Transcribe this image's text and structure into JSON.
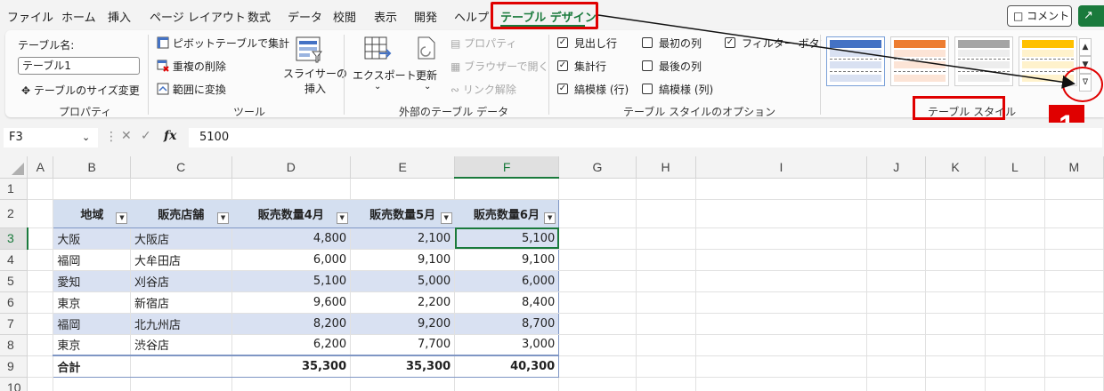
{
  "menu": {
    "items": [
      "ファイル",
      "ホーム",
      "挿入",
      "ページ レイアウト",
      "数式",
      "データ",
      "校閲",
      "表示",
      "開発",
      "ヘルプ",
      "テーブル デザイン"
    ],
    "comment_label": "コメント",
    "share_label": "共有"
  },
  "ribbon": {
    "properties": {
      "table_name_label": "テーブル名:",
      "table_name_value": "テーブル1",
      "resize_label": "テーブルのサイズ変更",
      "group_label": "プロパティ"
    },
    "tools": {
      "pivot_label": "ピボットテーブルで集計",
      "remove_dup_label": "重複の削除",
      "convert_label": "範囲に変換",
      "slicer_label_1": "スライサーの",
      "slicer_label_2": "挿入",
      "group_label": "ツール"
    },
    "external": {
      "export_label": "エクスポート",
      "refresh_label": "更新",
      "properties_label": "プロパティ",
      "browser_label": "ブラウザーで開く",
      "unlink_label": "リンク解除",
      "group_label": "外部のテーブル データ"
    },
    "options": {
      "header_row": "見出し行",
      "total_row": "集計行",
      "banded_rows": "縞模様 (行)",
      "first_column": "最初の列",
      "last_column": "最後の列",
      "banded_columns": "縞模様 (列)",
      "filter_button": "フィルター ボタン",
      "group_label": "テーブル スタイルのオプション",
      "checked": {
        "header_row": true,
        "total_row": true,
        "banded_rows": true,
        "first_column": false,
        "last_column": false,
        "banded_columns": false,
        "filter_button": true
      }
    },
    "styles": {
      "group_label": "テーブル スタイル",
      "swatch_colors": [
        "#4472c4",
        "#ed7d31",
        "#a5a5a5",
        "#ffc000"
      ],
      "band_colors": [
        "#d9e1f2",
        "#fce4d6",
        "#ededed",
        "#fff2cc"
      ]
    }
  },
  "annotation": {
    "step_number": "1"
  },
  "formula_bar": {
    "name_box": "F3",
    "fx_label": "fx",
    "value": "5100"
  },
  "grid": {
    "columns": [
      "A",
      "B",
      "C",
      "D",
      "E",
      "F",
      "G",
      "H",
      "I",
      "J",
      "K",
      "L",
      "M"
    ],
    "rows": [
      "1",
      "2",
      "3",
      "4",
      "5",
      "6",
      "7",
      "8",
      "9",
      "10"
    ],
    "headers": [
      "地域",
      "販売店舗",
      "販売数量4月",
      "販売数量5月",
      "販売数量6月"
    ],
    "data": [
      [
        "大阪",
        "大阪店",
        "4,800",
        "2,100",
        "5,100"
      ],
      [
        "福岡",
        "大牟田店",
        "6,000",
        "9,100",
        "9,100"
      ],
      [
        "愛知",
        "刈谷店",
        "5,100",
        "5,000",
        "6,000"
      ],
      [
        "東京",
        "新宿店",
        "9,600",
        "2,200",
        "8,400"
      ],
      [
        "福岡",
        "北九州店",
        "8,200",
        "9,200",
        "8,700"
      ],
      [
        "東京",
        "渋谷店",
        "6,200",
        "7,700",
        "3,000"
      ]
    ],
    "total": [
      "合計",
      "",
      "35,300",
      "35,300",
      "40,300"
    ],
    "selected_column": "F",
    "selected_row": "3"
  }
}
